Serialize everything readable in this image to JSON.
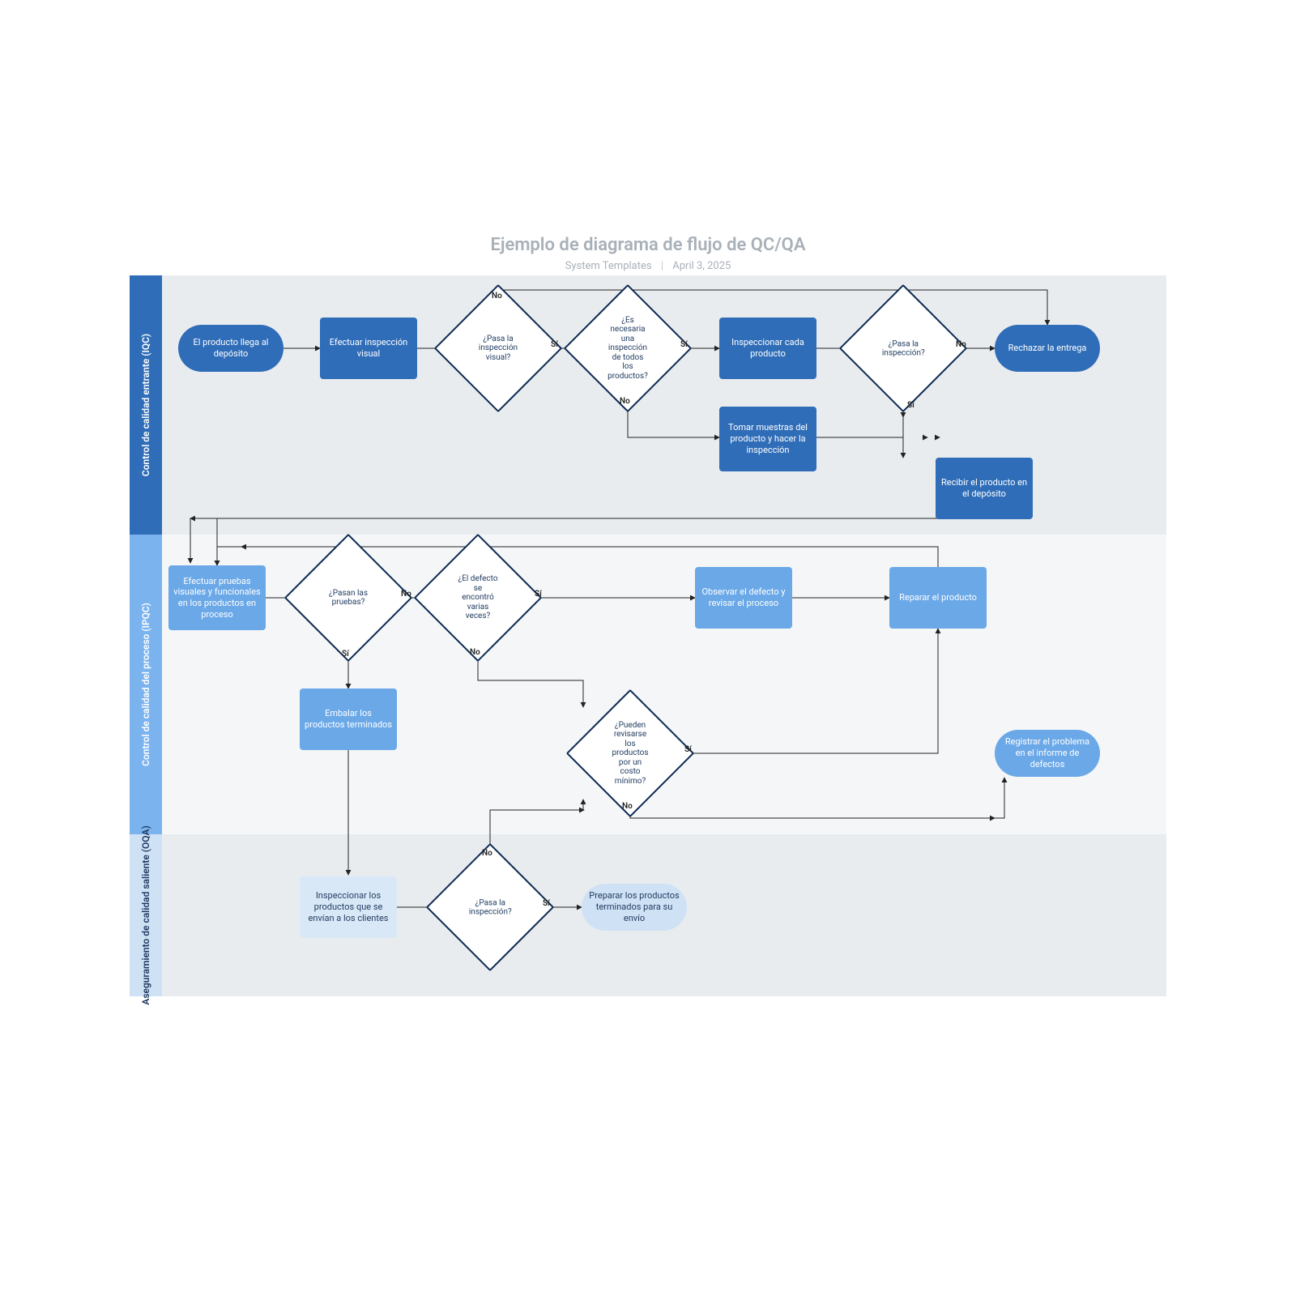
{
  "header": {
    "title": "Ejemplo de diagrama de flujo de QC/QA",
    "author": "System Templates",
    "date": "April 3, 2025"
  },
  "lanes": {
    "iqc": "Control de calidad entrante (IQC)",
    "ipqc": "Control de calidad del proceso (IPQC)",
    "oqa": "Aseguramiento de calidad saliente (OQA)"
  },
  "nodes": {
    "start": "El producto llega al depósito",
    "visual": "Efectuar inspección visual",
    "d_passVisual": "¿Pasa la inspección visual?",
    "d_needAll": "¿Es necesaria una inspección de todos los productos?",
    "inspectEach": "Inspeccionar cada producto",
    "d_passInsp": "¿Pasa la inspección?",
    "reject": "Rechazar la entrega",
    "sample": "Tomar muestras del producto y hacer la inspección",
    "receive": "Recibir el producto en el depósito",
    "tests": "Efectuar pruebas visuales y funcionales en los productos en proceso",
    "d_passTests": "¿Pasan las pruebas?",
    "d_multiDefect": "¿El defecto se encontró varias veces?",
    "observe": "Observar el defecto y revisar el proceso",
    "repair": "Reparar el producto",
    "pack": "Embalar los productos terminados",
    "d_minCost": "¿Pueden revisarse los productos por un costo mínimo?",
    "log": "Registrar el problema en el informe de defectos",
    "inspectShip": "Inspeccionar los productos que se envían a los clientes",
    "d_passFinal": "¿Pasa la inspección?",
    "prepare": "Preparar los productos terminados para su envío"
  },
  "labels": {
    "yes": "Sí",
    "no": "No"
  },
  "chart_data": {
    "type": "swimlane-flowchart",
    "lanes": [
      {
        "id": "IQC",
        "label": "Control de calidad entrante (IQC)"
      },
      {
        "id": "IPQC",
        "label": "Control de calidad del proceso (IPQC)"
      },
      {
        "id": "OQA",
        "label": "Aseguramiento de calidad saliente (OQA)"
      }
    ],
    "nodes": [
      {
        "id": "start",
        "lane": "IQC",
        "type": "terminator",
        "text": "El producto llega al depósito"
      },
      {
        "id": "visual",
        "lane": "IQC",
        "type": "process",
        "text": "Efectuar inspección visual"
      },
      {
        "id": "d_passVisual",
        "lane": "IQC",
        "type": "decision",
        "text": "¿Pasa la inspección visual?"
      },
      {
        "id": "d_needAll",
        "lane": "IQC",
        "type": "decision",
        "text": "¿Es necesaria una inspección de todos los productos?"
      },
      {
        "id": "inspectEach",
        "lane": "IQC",
        "type": "process",
        "text": "Inspeccionar cada producto"
      },
      {
        "id": "d_passInsp",
        "lane": "IQC",
        "type": "decision",
        "text": "¿Pasa la inspección?"
      },
      {
        "id": "reject",
        "lane": "IQC",
        "type": "terminator",
        "text": "Rechazar la entrega"
      },
      {
        "id": "sample",
        "lane": "IQC",
        "type": "process",
        "text": "Tomar muestras del producto y hacer la inspección"
      },
      {
        "id": "receive",
        "lane": "IQC",
        "type": "process",
        "text": "Recibir el producto en el depósito"
      },
      {
        "id": "tests",
        "lane": "IPQC",
        "type": "process",
        "text": "Efectuar pruebas visuales y funcionales en los productos en proceso"
      },
      {
        "id": "d_passTests",
        "lane": "IPQC",
        "type": "decision",
        "text": "¿Pasan las pruebas?"
      },
      {
        "id": "d_multiDefect",
        "lane": "IPQC",
        "type": "decision",
        "text": "¿El defecto se encontró varias veces?"
      },
      {
        "id": "observe",
        "lane": "IPQC",
        "type": "process",
        "text": "Observar el defecto y revisar el proceso"
      },
      {
        "id": "repair",
        "lane": "IPQC",
        "type": "process",
        "text": "Reparar el producto"
      },
      {
        "id": "pack",
        "lane": "IPQC",
        "type": "process",
        "text": "Embalar los productos terminados"
      },
      {
        "id": "d_minCost",
        "lane": "IPQC",
        "type": "decision",
        "text": "¿Pueden revisarse los productos por un costo mínimo?"
      },
      {
        "id": "log",
        "lane": "IPQC",
        "type": "terminator",
        "text": "Registrar el problema en el informe de defectos"
      },
      {
        "id": "inspectShip",
        "lane": "OQA",
        "type": "process",
        "text": "Inspeccionar los productos que se envían a los clientes"
      },
      {
        "id": "d_passFinal",
        "lane": "OQA",
        "type": "decision",
        "text": "¿Pasa la inspección?"
      },
      {
        "id": "prepare",
        "lane": "OQA",
        "type": "terminator",
        "text": "Preparar los productos terminados para su envío"
      }
    ],
    "edges": [
      {
        "from": "start",
        "to": "visual"
      },
      {
        "from": "visual",
        "to": "d_passVisual"
      },
      {
        "from": "d_passVisual",
        "to": "d_needAll",
        "label": "Sí"
      },
      {
        "from": "d_passVisual",
        "to": "reject",
        "label": "No"
      },
      {
        "from": "d_needAll",
        "to": "inspectEach",
        "label": "Sí"
      },
      {
        "from": "d_needAll",
        "to": "sample",
        "label": "No"
      },
      {
        "from": "inspectEach",
        "to": "d_passInsp"
      },
      {
        "from": "sample",
        "to": "d_passInsp"
      },
      {
        "from": "d_passInsp",
        "to": "reject",
        "label": "No"
      },
      {
        "from": "d_passInsp",
        "to": "receive",
        "label": "Sí"
      },
      {
        "from": "receive",
        "to": "tests"
      },
      {
        "from": "tests",
        "to": "d_passTests"
      },
      {
        "from": "d_passTests",
        "to": "pack",
        "label": "Sí"
      },
      {
        "from": "d_passTests",
        "to": "d_multiDefect",
        "label": "No"
      },
      {
        "from": "d_multiDefect",
        "to": "observe",
        "label": "Sí"
      },
      {
        "from": "d_multiDefect",
        "to": "d_minCost",
        "label": "No"
      },
      {
        "from": "observe",
        "to": "repair"
      },
      {
        "from": "repair",
        "to": "tests"
      },
      {
        "from": "d_minCost",
        "to": "repair",
        "label": "Sí"
      },
      {
        "from": "d_minCost",
        "to": "log",
        "label": "No"
      },
      {
        "from": "pack",
        "to": "inspectShip"
      },
      {
        "from": "inspectShip",
        "to": "d_passFinal"
      },
      {
        "from": "d_passFinal",
        "to": "prepare",
        "label": "Sí"
      },
      {
        "from": "d_passFinal",
        "to": "d_minCost",
        "label": "No"
      }
    ]
  }
}
